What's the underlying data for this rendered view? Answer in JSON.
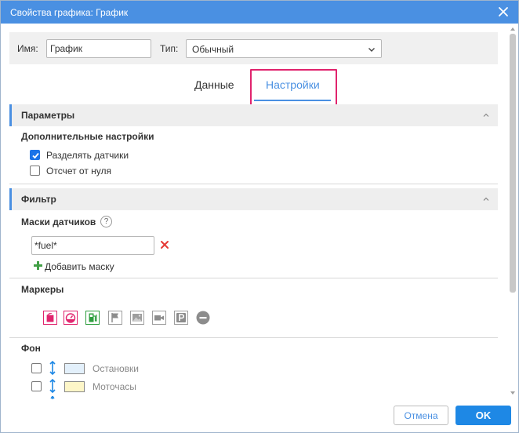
{
  "window": {
    "title": "Свойства графика: График",
    "close_icon": "close-icon"
  },
  "namebar": {
    "name_label": "Имя:",
    "name_value": "График",
    "type_label": "Тип:",
    "type_value": "Обычный"
  },
  "tabs": [
    {
      "label": "Данные",
      "active": false
    },
    {
      "label": "Настройки",
      "active": true
    }
  ],
  "params": {
    "header": "Параметры",
    "subheader": "Дополнительные настройки",
    "options": [
      {
        "label": "Разделять датчики",
        "checked": true
      },
      {
        "label": "Отсчет от нуля",
        "checked": false
      }
    ]
  },
  "filter": {
    "header": "Фильтр",
    "masks_label": "Маски датчиков",
    "help_glyph": "?",
    "mask_value": "*fuel*",
    "add_mask_label": "Добавить маску"
  },
  "markers": {
    "label": "Маркеры",
    "icons": [
      {
        "name": "fuel-fill-marker-icon",
        "state": "active",
        "color": "#e0236d"
      },
      {
        "name": "gauge-marker-icon",
        "state": "active",
        "color": "#e0236d"
      },
      {
        "name": "fuel-station-marker-icon",
        "state": "active",
        "color": "#2e9e3e"
      },
      {
        "name": "flag-marker-icon",
        "state": "inactive",
        "color": "#8c8c8c"
      },
      {
        "name": "image-marker-icon",
        "state": "inactive",
        "color": "#8c8c8c"
      },
      {
        "name": "video-marker-icon",
        "state": "inactive",
        "color": "#8c8c8c"
      },
      {
        "name": "parking-marker-icon",
        "state": "inactive",
        "color": "#8c8c8c"
      },
      {
        "name": "minus-circle-marker-icon",
        "state": "inactive",
        "color": "#8c8c8c"
      }
    ]
  },
  "background": {
    "label": "Фон",
    "items": [
      {
        "label": "Остановки",
        "checked": false,
        "color": "#e3f0fb"
      },
      {
        "label": "Моточасы",
        "checked": false,
        "color": "#fdf6c8"
      }
    ]
  },
  "footer": {
    "cancel_label": "Отмена",
    "ok_label": "OK"
  },
  "colors": {
    "accent": "#4a90e2",
    "highlight": "#e0236d",
    "ok_button": "#1e88e5"
  }
}
